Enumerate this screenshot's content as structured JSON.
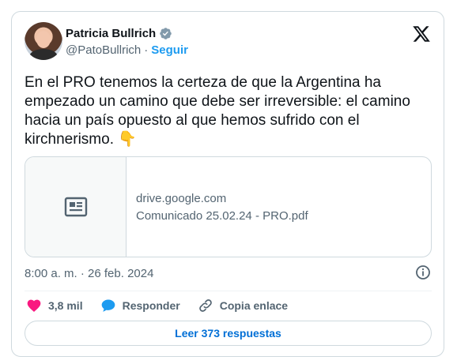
{
  "author": {
    "name": "Patricia Bullrich",
    "handle": "@PatoBullrich",
    "separator": "·",
    "follow_label": "Seguir"
  },
  "tweet": {
    "text": "En el PRO tenemos la certeza de que la Argentina ha empezado un camino que debe ser irreversible: el camino hacia un país opuesto al que hemos sufrido con el kirchnerismo.",
    "emoji": "👇"
  },
  "link_card": {
    "domain": "drive.google.com",
    "title": "Comunicado 25.02.24 - PRO.pdf"
  },
  "timestamp": "8:00 a. m. · 26 feb. 2024",
  "actions": {
    "likes_count": "3,8 mil",
    "reply_label": "Responder",
    "copy_label": "Copia enlace"
  },
  "read_replies_label": "Leer 373 respuestas",
  "colors": {
    "accent": "#1d9bf0",
    "like": "#f91880",
    "link_button": "#006fd6",
    "muted": "#536471"
  }
}
